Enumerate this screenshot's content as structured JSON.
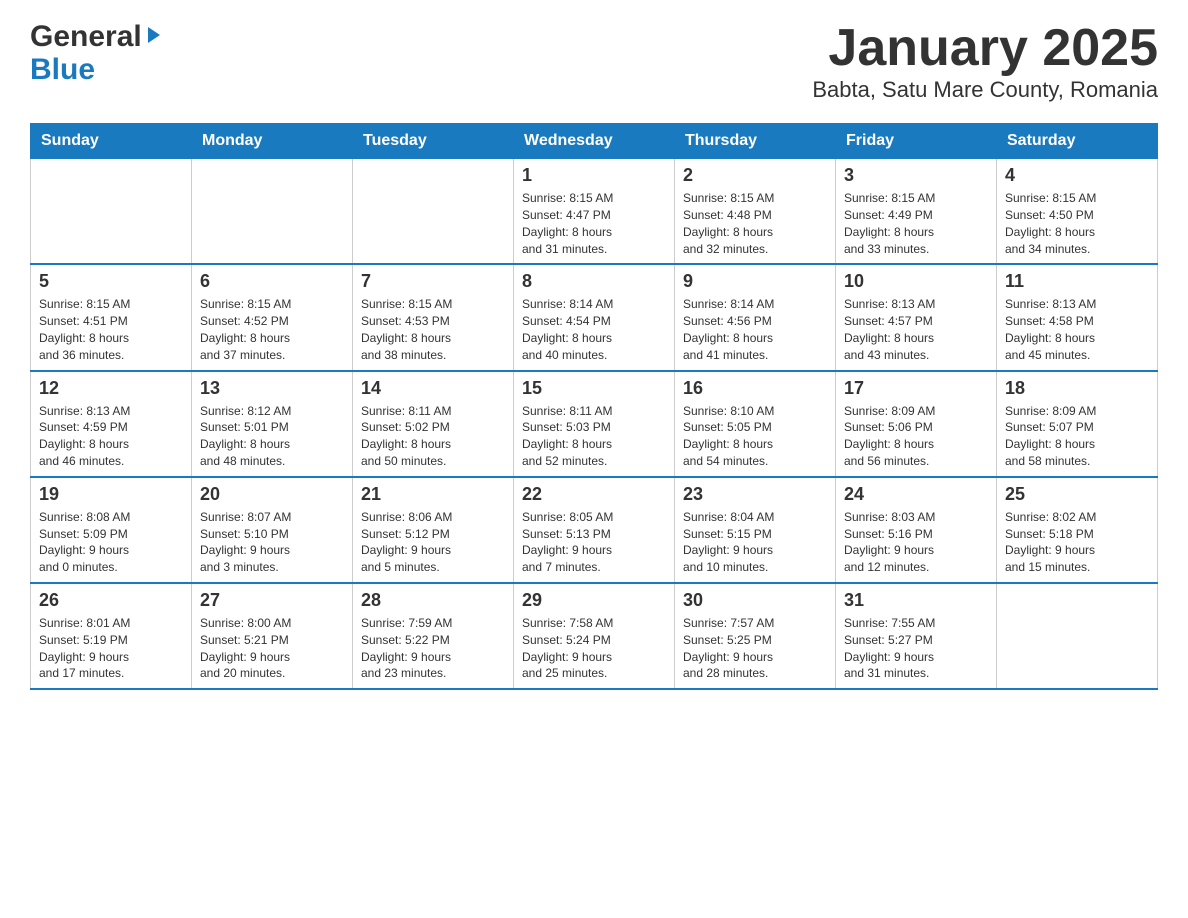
{
  "logo": {
    "general": "General",
    "blue": "Blue",
    "arrow": "▶"
  },
  "title": "January 2025",
  "subtitle": "Babta, Satu Mare County, Romania",
  "headers": [
    "Sunday",
    "Monday",
    "Tuesday",
    "Wednesday",
    "Thursday",
    "Friday",
    "Saturday"
  ],
  "weeks": [
    [
      {
        "day": "",
        "info": ""
      },
      {
        "day": "",
        "info": ""
      },
      {
        "day": "",
        "info": ""
      },
      {
        "day": "1",
        "info": "Sunrise: 8:15 AM\nSunset: 4:47 PM\nDaylight: 8 hours\nand 31 minutes."
      },
      {
        "day": "2",
        "info": "Sunrise: 8:15 AM\nSunset: 4:48 PM\nDaylight: 8 hours\nand 32 minutes."
      },
      {
        "day": "3",
        "info": "Sunrise: 8:15 AM\nSunset: 4:49 PM\nDaylight: 8 hours\nand 33 minutes."
      },
      {
        "day": "4",
        "info": "Sunrise: 8:15 AM\nSunset: 4:50 PM\nDaylight: 8 hours\nand 34 minutes."
      }
    ],
    [
      {
        "day": "5",
        "info": "Sunrise: 8:15 AM\nSunset: 4:51 PM\nDaylight: 8 hours\nand 36 minutes."
      },
      {
        "day": "6",
        "info": "Sunrise: 8:15 AM\nSunset: 4:52 PM\nDaylight: 8 hours\nand 37 minutes."
      },
      {
        "day": "7",
        "info": "Sunrise: 8:15 AM\nSunset: 4:53 PM\nDaylight: 8 hours\nand 38 minutes."
      },
      {
        "day": "8",
        "info": "Sunrise: 8:14 AM\nSunset: 4:54 PM\nDaylight: 8 hours\nand 40 minutes."
      },
      {
        "day": "9",
        "info": "Sunrise: 8:14 AM\nSunset: 4:56 PM\nDaylight: 8 hours\nand 41 minutes."
      },
      {
        "day": "10",
        "info": "Sunrise: 8:13 AM\nSunset: 4:57 PM\nDaylight: 8 hours\nand 43 minutes."
      },
      {
        "day": "11",
        "info": "Sunrise: 8:13 AM\nSunset: 4:58 PM\nDaylight: 8 hours\nand 45 minutes."
      }
    ],
    [
      {
        "day": "12",
        "info": "Sunrise: 8:13 AM\nSunset: 4:59 PM\nDaylight: 8 hours\nand 46 minutes."
      },
      {
        "day": "13",
        "info": "Sunrise: 8:12 AM\nSunset: 5:01 PM\nDaylight: 8 hours\nand 48 minutes."
      },
      {
        "day": "14",
        "info": "Sunrise: 8:11 AM\nSunset: 5:02 PM\nDaylight: 8 hours\nand 50 minutes."
      },
      {
        "day": "15",
        "info": "Sunrise: 8:11 AM\nSunset: 5:03 PM\nDaylight: 8 hours\nand 52 minutes."
      },
      {
        "day": "16",
        "info": "Sunrise: 8:10 AM\nSunset: 5:05 PM\nDaylight: 8 hours\nand 54 minutes."
      },
      {
        "day": "17",
        "info": "Sunrise: 8:09 AM\nSunset: 5:06 PM\nDaylight: 8 hours\nand 56 minutes."
      },
      {
        "day": "18",
        "info": "Sunrise: 8:09 AM\nSunset: 5:07 PM\nDaylight: 8 hours\nand 58 minutes."
      }
    ],
    [
      {
        "day": "19",
        "info": "Sunrise: 8:08 AM\nSunset: 5:09 PM\nDaylight: 9 hours\nand 0 minutes."
      },
      {
        "day": "20",
        "info": "Sunrise: 8:07 AM\nSunset: 5:10 PM\nDaylight: 9 hours\nand 3 minutes."
      },
      {
        "day": "21",
        "info": "Sunrise: 8:06 AM\nSunset: 5:12 PM\nDaylight: 9 hours\nand 5 minutes."
      },
      {
        "day": "22",
        "info": "Sunrise: 8:05 AM\nSunset: 5:13 PM\nDaylight: 9 hours\nand 7 minutes."
      },
      {
        "day": "23",
        "info": "Sunrise: 8:04 AM\nSunset: 5:15 PM\nDaylight: 9 hours\nand 10 minutes."
      },
      {
        "day": "24",
        "info": "Sunrise: 8:03 AM\nSunset: 5:16 PM\nDaylight: 9 hours\nand 12 minutes."
      },
      {
        "day": "25",
        "info": "Sunrise: 8:02 AM\nSunset: 5:18 PM\nDaylight: 9 hours\nand 15 minutes."
      }
    ],
    [
      {
        "day": "26",
        "info": "Sunrise: 8:01 AM\nSunset: 5:19 PM\nDaylight: 9 hours\nand 17 minutes."
      },
      {
        "day": "27",
        "info": "Sunrise: 8:00 AM\nSunset: 5:21 PM\nDaylight: 9 hours\nand 20 minutes."
      },
      {
        "day": "28",
        "info": "Sunrise: 7:59 AM\nSunset: 5:22 PM\nDaylight: 9 hours\nand 23 minutes."
      },
      {
        "day": "29",
        "info": "Sunrise: 7:58 AM\nSunset: 5:24 PM\nDaylight: 9 hours\nand 25 minutes."
      },
      {
        "day": "30",
        "info": "Sunrise: 7:57 AM\nSunset: 5:25 PM\nDaylight: 9 hours\nand 28 minutes."
      },
      {
        "day": "31",
        "info": "Sunrise: 7:55 AM\nSunset: 5:27 PM\nDaylight: 9 hours\nand 31 minutes."
      },
      {
        "day": "",
        "info": ""
      }
    ]
  ]
}
